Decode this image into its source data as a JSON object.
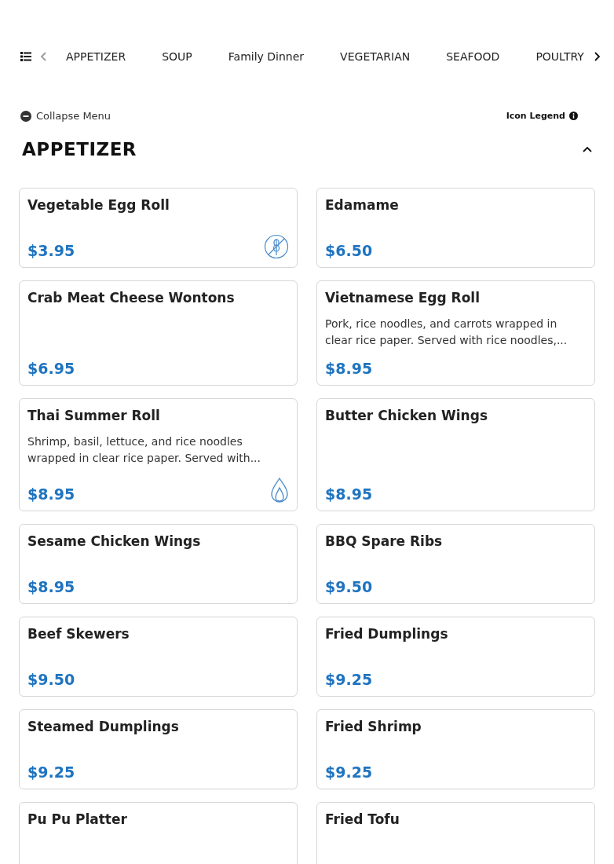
{
  "category_nav": {
    "tabs": [
      {
        "label": "APPETIZER"
      },
      {
        "label": "SOUP"
      },
      {
        "label": "Family Dinner"
      },
      {
        "label": "VEGETARIAN"
      },
      {
        "label": "SEAFOOD"
      },
      {
        "label": "POULTRY"
      }
    ]
  },
  "collapse_menu": {
    "label": "Collapse Menu"
  },
  "icon_legend": {
    "label": "Icon Legend"
  },
  "section": {
    "title": "APPETIZER",
    "expanded": true,
    "items": [
      {
        "name": "Vegetable Egg Roll",
        "price": "$3.95",
        "icons": [
          {
            "kind": "gluten_free"
          }
        ]
      },
      {
        "name": "Edamame",
        "price": "$6.50"
      },
      {
        "name": "Crab Meat Cheese Wontons",
        "price": "$6.95"
      },
      {
        "name": "Vietnamese Egg Roll",
        "description": "Pork, rice noodles, and carrots wrapped in clear rice paper. Served with rice noodles,...",
        "price": "$8.95"
      },
      {
        "name": "Thai Summer Roll",
        "description": "Shrimp, basil, lettuce, and rice noodles wrapped in clear rice paper. Served with...",
        "price": "$8.95",
        "icons": [
          {
            "kind": "spicy"
          }
        ]
      },
      {
        "name": "Butter Chicken Wings",
        "price": "$8.95"
      },
      {
        "name": "Sesame Chicken Wings",
        "price": "$8.95"
      },
      {
        "name": "BBQ Spare Ribs",
        "price": "$9.50"
      },
      {
        "name": "Beef Skewers",
        "price": "$9.50"
      },
      {
        "name": "Fried Dumplings",
        "price": "$9.25"
      },
      {
        "name": "Steamed Dumplings",
        "price": "$9.25"
      },
      {
        "name": "Fried Shrimp",
        "price": "$9.25"
      },
      {
        "name": "Pu Pu Platter"
      },
      {
        "name": "Fried Tofu"
      }
    ]
  }
}
